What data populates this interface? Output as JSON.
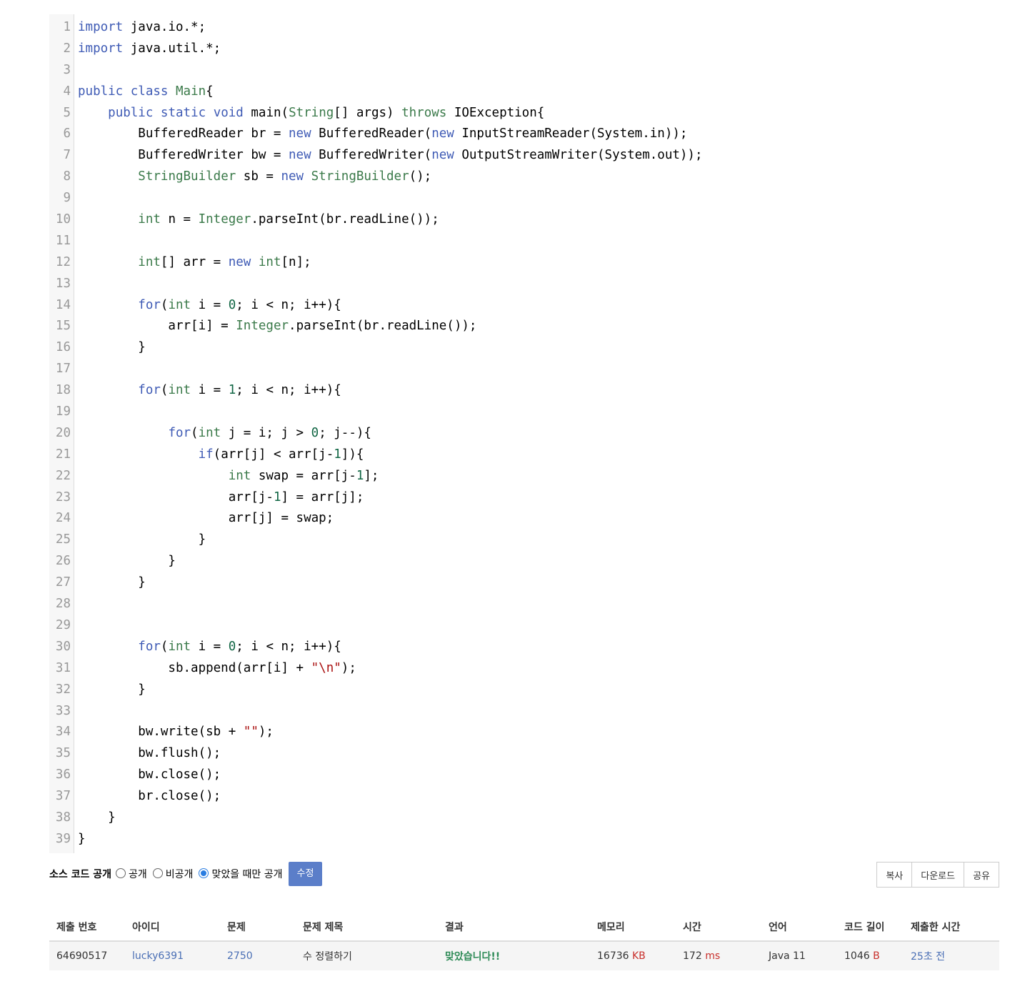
{
  "code": {
    "lines": [
      "1",
      "2",
      "3",
      "4",
      "5",
      "6",
      "7",
      "8",
      "9",
      "10",
      "11",
      "12",
      "13",
      "14",
      "15",
      "16",
      "17",
      "18",
      "19",
      "20",
      "21",
      "22",
      "23",
      "24",
      "25",
      "26",
      "27",
      "28",
      "29",
      "30",
      "31",
      "32",
      "33",
      "34",
      "35",
      "36",
      "37",
      "38",
      "39"
    ]
  },
  "options": {
    "title": "소스 코드 공개",
    "public_label": "공개",
    "private_label": "비공개",
    "correct_only_label": "맞았을 때만 공개",
    "selected": "correct_only",
    "edit_button": "수정"
  },
  "actions": {
    "copy": "복사",
    "download": "다운로드",
    "share": "공유"
  },
  "table": {
    "headers": [
      "제출 번호",
      "아이디",
      "문제",
      "문제 제목",
      "결과",
      "메모리",
      "시간",
      "언어",
      "코드 길이",
      "제출한 시간"
    ],
    "row": {
      "submission_id": "64690517",
      "user_id": "lucky6391",
      "problem_id": "2750",
      "problem_title": "수 정렬하기",
      "result": "맞았습니다!!",
      "memory": "16736",
      "memory_unit": "KB",
      "time": "172",
      "time_unit": "ms",
      "language": "Java 11",
      "code_length": "1046",
      "code_length_unit": "B",
      "submitted": "25초 전"
    }
  },
  "colors": {
    "keyword": "#770088",
    "type": "#3b7a4a",
    "number": "#116644",
    "string": "#aa1111",
    "edit_button": "#5b7ec9",
    "result_ok": "#2e8b57",
    "unit": "#c9302c",
    "link": "#4a6fb5"
  }
}
